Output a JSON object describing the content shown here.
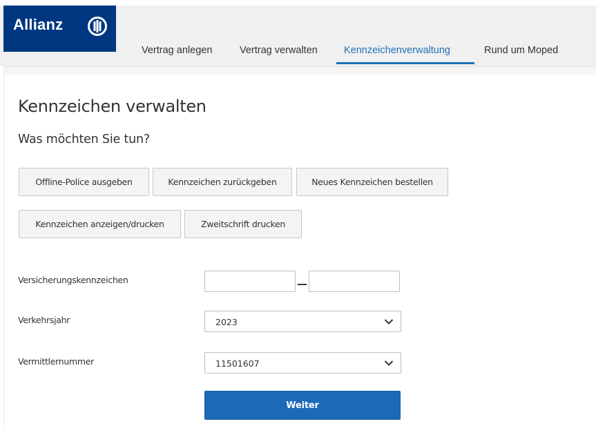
{
  "header": {
    "logo_text": "Allianz",
    "nav": [
      {
        "label": "Vertrag anlegen",
        "active": false
      },
      {
        "label": "Vertrag verwalten",
        "active": false
      },
      {
        "label": "Kennzeichenverwaltung",
        "active": true
      },
      {
        "label": "Rund um Moped",
        "active": false
      }
    ],
    "brand_color": "#003781",
    "accent_color": "#1f6fb5"
  },
  "page": {
    "title": "Kennzeichen verwalten",
    "subtitle": "Was möchten Sie tun?"
  },
  "actions": {
    "offline_police": "Offline-Police ausgeben",
    "kennzeichen_zurueckgeben": "Kennzeichen zurückgeben",
    "neues_kennzeichen": "Neues Kennzeichen bestellen",
    "kennzeichen_anzeigen": "Kennzeichen anzeigen/drucken",
    "zweitschrift": "Zweitschrift drucken"
  },
  "form": {
    "versicherungskennzeichen": {
      "label": "Versicherungskennzeichen",
      "part1": "",
      "part2": ""
    },
    "verkehrsjahr": {
      "label": "Verkehrsjahr",
      "value": "2023"
    },
    "vermittlernummer": {
      "label": "Vermittlernummer",
      "value": "11501607"
    },
    "submit_label": "Weiter"
  }
}
